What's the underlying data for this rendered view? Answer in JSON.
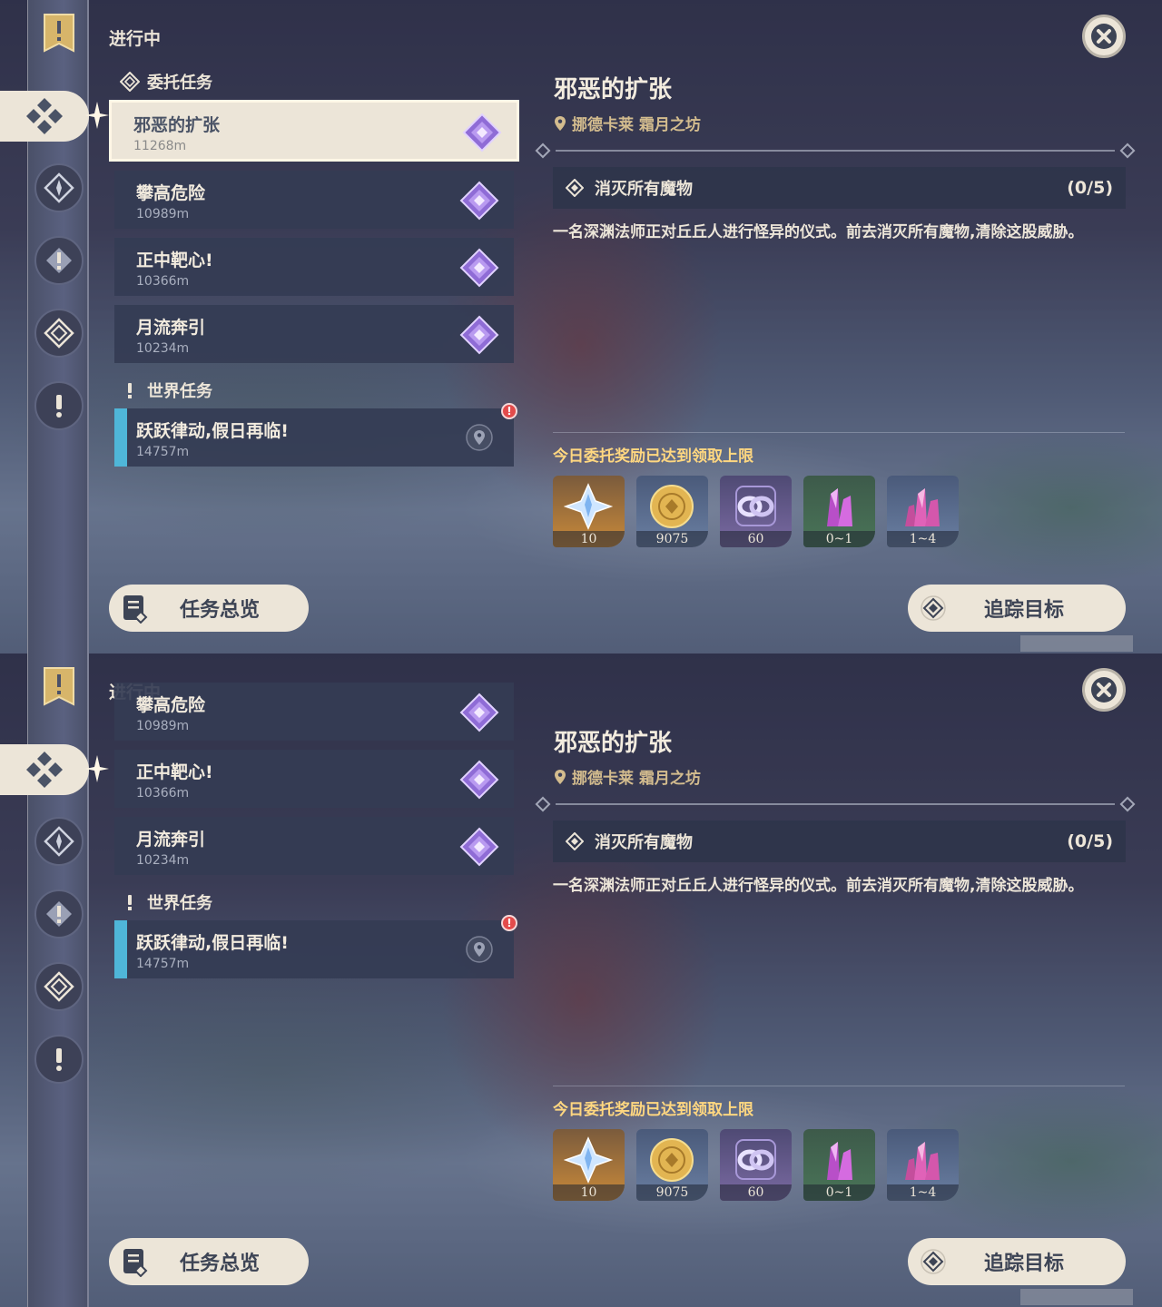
{
  "section_title": "进行中",
  "groups": {
    "commission": {
      "title": "委托任务"
    },
    "world": {
      "title": "世界任务"
    }
  },
  "quests": [
    {
      "name": "邪恶的扩张",
      "distance": "11268m"
    },
    {
      "name": "攀高危险",
      "distance": "10989m"
    },
    {
      "name": "正中靶心!",
      "distance": "10366m"
    },
    {
      "name": "月流奔引",
      "distance": "10234m"
    }
  ],
  "world_quests": [
    {
      "name": "跃跃律动,假日再临!",
      "distance": "14757m",
      "alert": "!"
    }
  ],
  "buttons": {
    "overview": "任务总览",
    "track": "追踪目标"
  },
  "detail": {
    "title": "邪恶的扩张",
    "location": "挪德卡莱 霜月之坊",
    "objective": "消灭所有魔物",
    "progress": "(0/5)",
    "description": "一名深渊法师正对丘丘人进行怪异的仪式。前去消灭所有魔物,清除这股威胁。",
    "reward_note": "今日委托奖励已达到领取上限"
  },
  "rewards": [
    {
      "icon": "primogem-icon",
      "count": "10"
    },
    {
      "icon": "mora-icon",
      "count": "9075"
    },
    {
      "icon": "companionship-exp-icon",
      "count": "60"
    },
    {
      "icon": "crystal-ore-icon",
      "count": "0~1"
    },
    {
      "icon": "crystal-cluster-icon",
      "count": "1~4"
    }
  ],
  "colors": {
    "accent": "#ece5d8",
    "reward_note": "#ffd780",
    "world_quest": "#4fb6d8",
    "alert": "#e34b4b"
  }
}
